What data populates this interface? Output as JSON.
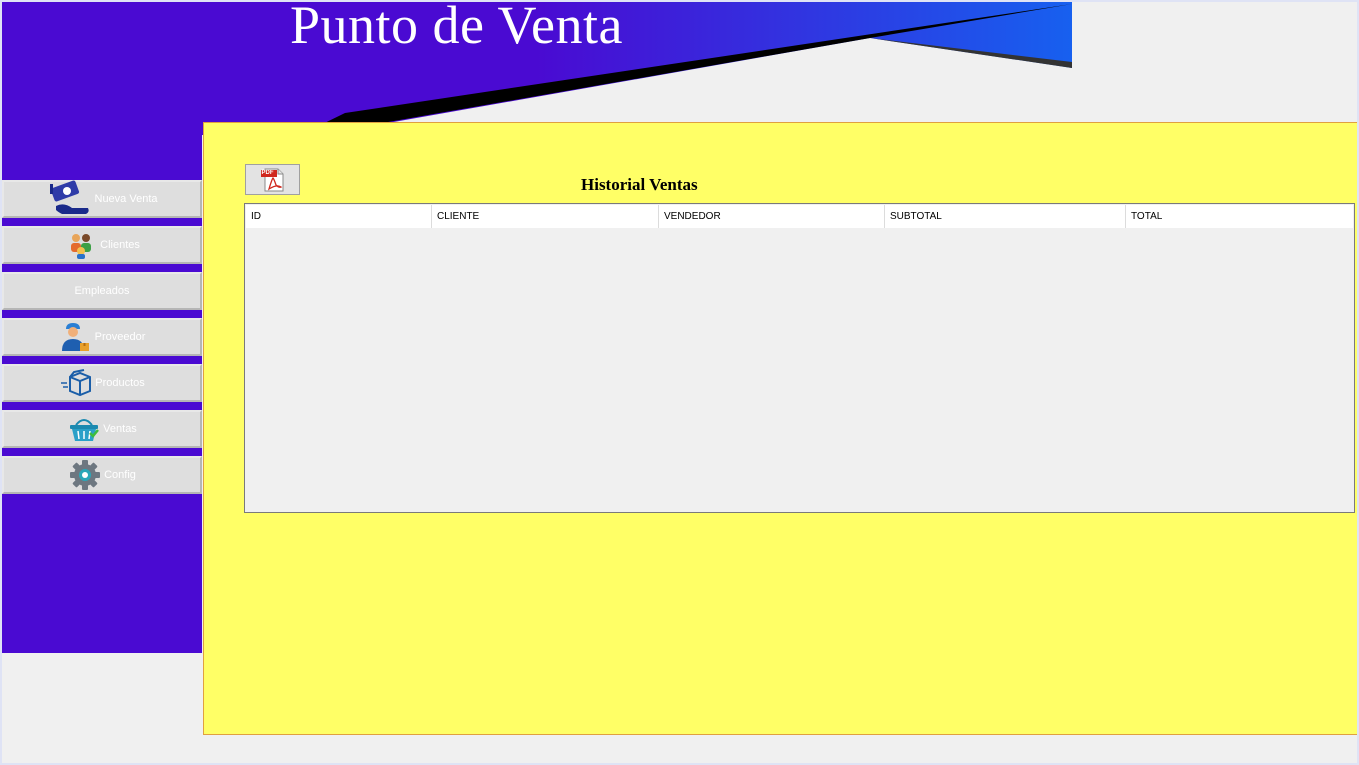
{
  "header": {
    "title": "Punto de Venta"
  },
  "sidebar": {
    "items": [
      {
        "label": "Nueva Venta",
        "icon": "money-hand-icon"
      },
      {
        "label": "Clientes",
        "icon": "clients-icon"
      },
      {
        "label": "Empleados",
        "icon": ""
      },
      {
        "label": "Proveedor",
        "icon": "delivery-person-icon"
      },
      {
        "label": "Productos",
        "icon": "box-icon"
      },
      {
        "label": "Ventas",
        "icon": "basket-icon"
      },
      {
        "label": "Config",
        "icon": "gear-icon"
      }
    ]
  },
  "main": {
    "title": "Historial Ventas",
    "export_button": {
      "icon": "pdf-icon",
      "icon_text": "PDF"
    },
    "table": {
      "columns": [
        "ID",
        "CLIENTE",
        "VENDEDOR",
        "SUBTOTAL",
        "TOTAL"
      ],
      "rows": []
    }
  },
  "colors": {
    "sidebar_bg": "#4a0ad2",
    "panel_bg": "#ffff66",
    "banner_start": "#4a0ad2",
    "banner_end": "#1760ef"
  }
}
